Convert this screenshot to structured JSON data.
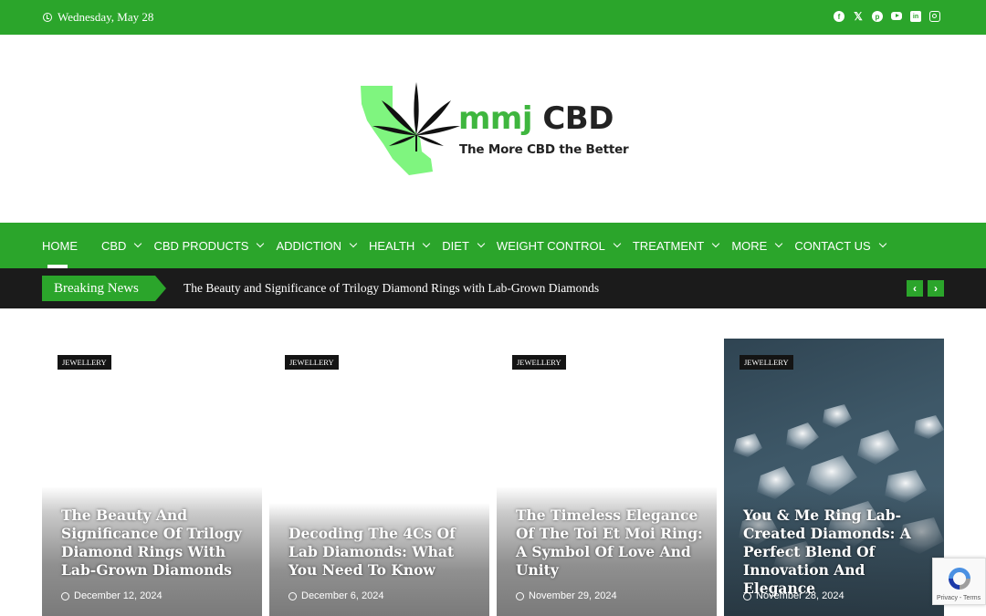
{
  "topbar": {
    "date": "Wednesday, May 28",
    "social": [
      "facebook-icon",
      "x-icon",
      "pinterest-icon",
      "youtube-icon",
      "linkedin-icon",
      "instagram-icon"
    ]
  },
  "logo": {
    "brand_green": "mmj",
    "brand_dark": "CBD",
    "tagline": "The More CBD the Better"
  },
  "nav": {
    "items": [
      {
        "label": "HOME"
      },
      {
        "label": "CBD"
      },
      {
        "label": "CBD PRODUCTS"
      },
      {
        "label": "ADDICTION"
      },
      {
        "label": "HEALTH"
      },
      {
        "label": "DIET"
      },
      {
        "label": "WEIGHT CONTROL"
      },
      {
        "label": "TREATMENT"
      },
      {
        "label": "MORE"
      },
      {
        "label": "CONTACT US"
      }
    ]
  },
  "breaking": {
    "label": "Breaking News",
    "headline": "The Beauty and Significance of Trilogy Diamond Rings with Lab-Grown Diamonds"
  },
  "cards": [
    {
      "category": "JEWELLERY",
      "title": "The Beauty And Significance Of Trilogy Diamond Rings With Lab-Grown Diamonds",
      "date": "December 12, 2024"
    },
    {
      "category": "JEWELLERY",
      "title": "Decoding The 4Cs Of Lab Diamonds: What You Need To Know",
      "date": "December 6, 2024"
    },
    {
      "category": "JEWELLERY",
      "title": "The Timeless Elegance Of The Toi Et Moi Ring: A Symbol Of Love And Unity",
      "date": "November 29, 2024"
    },
    {
      "category": "JEWELLERY",
      "title": "You & Me Ring Lab-Created Diamonds: A Perfect Blend Of Innovation And Elegance",
      "date": "November 28, 2024"
    }
  ],
  "recaptcha": {
    "text": "Privacy - Terms"
  },
  "colors": {
    "brand_green": "#2ba52b",
    "dark": "#1b1b1b"
  }
}
